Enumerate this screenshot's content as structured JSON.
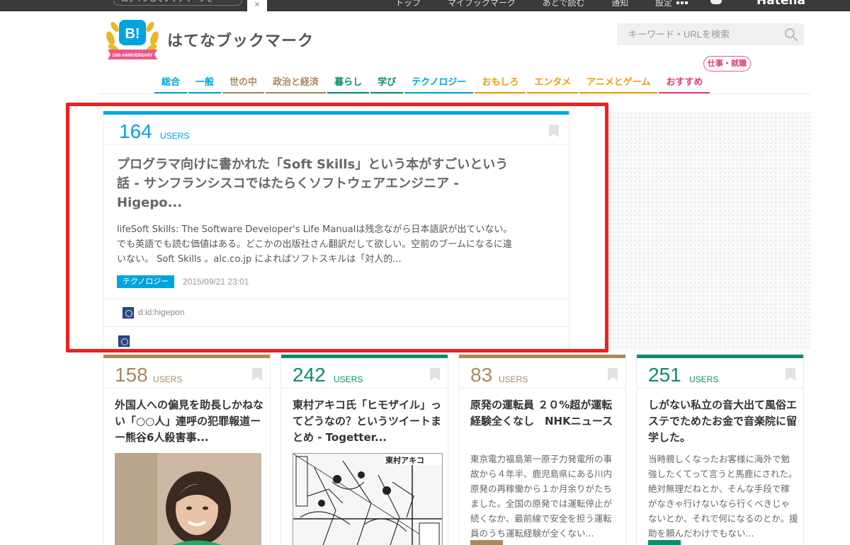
{
  "topbar": {
    "pill_text": "ログインしてブックマークを",
    "tab_mark": "×",
    "links": [
      "トップ",
      "マイブックマーク",
      "あとで読む",
      "通知",
      "設定"
    ],
    "brand": "Hatena"
  },
  "header": {
    "site_title": "はてなブックマーク",
    "logo_badge": "B!",
    "logo_ribbon": "10th ANNIVERSARY"
  },
  "search": {
    "placeholder": "キーワード・URLを検索"
  },
  "nav": {
    "items": [
      {
        "label": "総合",
        "color": "#00a4de"
      },
      {
        "label": "一般",
        "color": "#00a4de"
      },
      {
        "label": "世の中",
        "color": "#a88a5e"
      },
      {
        "label": "政治と経済",
        "color": "#a88a5e"
      },
      {
        "label": "暮らし",
        "color": "#0c8c6e"
      },
      {
        "label": "学び",
        "color": "#0c8c6e"
      },
      {
        "label": "テクノロジー",
        "color": "#00a4de"
      },
      {
        "label": "おもしろ",
        "color": "#e8a012"
      },
      {
        "label": "エンタメ",
        "color": "#e8a012"
      },
      {
        "label": "アニメとゲーム",
        "color": "#e8a012"
      },
      {
        "label": "おすすめ",
        "color": "#e23d6d"
      }
    ],
    "bubble": "仕事・就職"
  },
  "hero": {
    "count": "164",
    "unit": "USERS",
    "title": "プログラマ向けに書かれた「Soft Skills」という本がすごいという話 - サンフランシスコではたらくソフトウェアエンジニア - Higepo...",
    "description": "lifeSoft Skills: The Software Developer's Life Manualは残念ながら日本語訳が出ていない。でも英語でも読む価値はある。どこかの出版社さん翻訳だして欲しい。空前のブームになるに違いない。 Soft Skills 。alc.co.jp によればソフトスキルは「対人的...",
    "tag": "テクノロジー",
    "date": "2015/09/21 23:01",
    "author": "d:id:higepon",
    "accent": "#00a4de"
  },
  "cards": [
    {
      "count": "158",
      "unit": "USERS",
      "title": "外国人への偏見を助長しかねない「○○人」連呼の犯罪報道ーー熊谷6人殺害事...",
      "description": "",
      "media": "photo",
      "accent": "#a88a5e"
    },
    {
      "count": "242",
      "unit": "USERS",
      "title": "東村アキコ氏「ヒモザイル」ってどうなの？というツイートまとめ - Togetter...",
      "description": "",
      "media": "manga",
      "media_label": "東村アキコ",
      "accent": "#0c8c6e"
    },
    {
      "count": "83",
      "unit": "USERS",
      "title": "原発の運転員 ２０%超が運転経験全くなし　NHKニュース",
      "description": "東京電力福島第一原子力発電所の事故から４年半、鹿児島県にある川内原発の再稼働から１か月余りがたちました。全国の原発では運転停止が続くなか、最前線で安全を担う運転員のうち運転経験が全くない...",
      "accent": "#a88a5e"
    },
    {
      "count": "251",
      "unit": "USERS",
      "title": "しがない私立の音大出て風俗エステでためたお金で音楽院に留学した。",
      "description": "当時親しくなったお客様に海外で勉強したくてって言うと馬鹿にされた。絶対無理だねとか、そんな手段で稼がなきゃ行けないなら行くべきじゃないとか、それで何になるのとか。援助を頼んだわけでもない...",
      "accent": "#0c8c6e"
    }
  ]
}
